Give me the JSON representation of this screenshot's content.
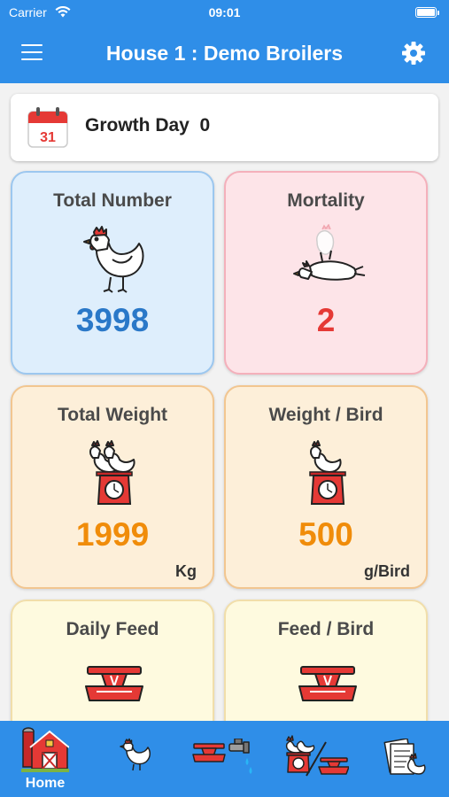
{
  "status_bar": {
    "carrier": "Carrier",
    "time": "09:01"
  },
  "header": {
    "title": "House 1 : Demo Broilers"
  },
  "growth": {
    "label": "Growth Day  0",
    "calendar_day": "31"
  },
  "cards": {
    "total_number": {
      "title": "Total Number",
      "value": "3998"
    },
    "mortality": {
      "title": "Mortality",
      "value": "2"
    },
    "total_weight": {
      "title": "Total Weight",
      "value": "1999",
      "unit": "Kg"
    },
    "weight_per_bird": {
      "title": "Weight / Bird",
      "value": "500",
      "unit": "g/Bird"
    },
    "daily_feed": {
      "title": "Daily Feed"
    },
    "feed_per_bird": {
      "title": "Feed / Bird"
    }
  },
  "bottom_nav": {
    "home_label": "Home"
  },
  "colors": {
    "brand_blue": "#2f8ee8",
    "number_blue": "#2a78c8",
    "mortality_red": "#e53935",
    "weight_orange": "#f08c0a"
  }
}
